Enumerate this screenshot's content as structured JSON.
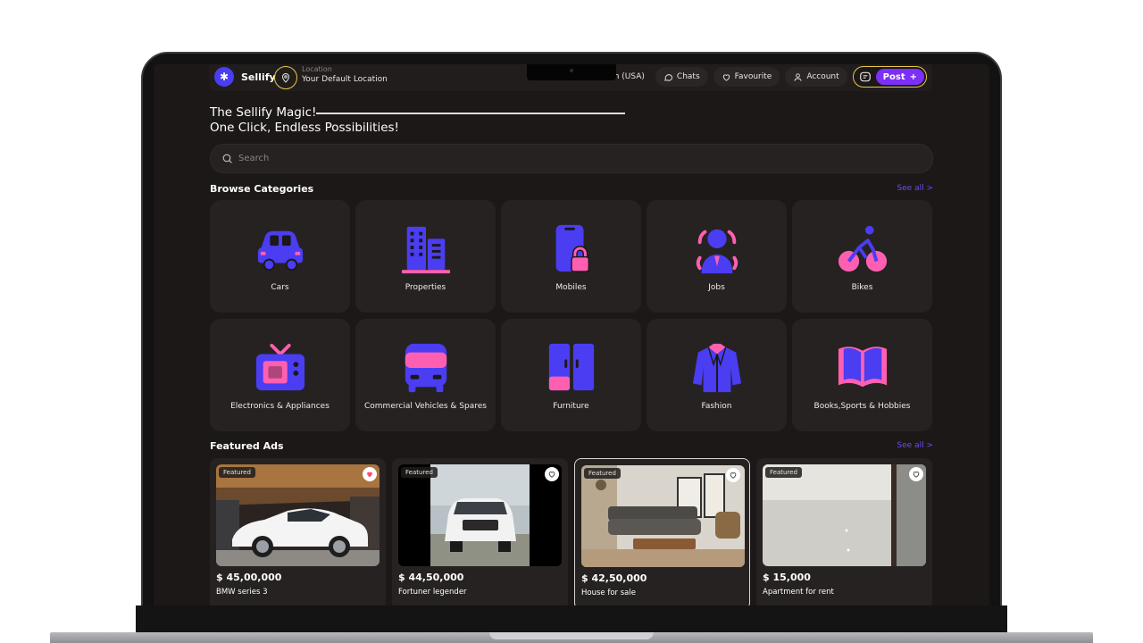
{
  "header": {
    "brand": "Sellify",
    "location_label": "Location",
    "location_value": "Your Default Location",
    "language": "English (USA)",
    "chats": "Chats",
    "favourite": "Favourite",
    "account": "Account",
    "post": "Post",
    "post_plus": "+"
  },
  "hero": {
    "line1": "The Sellify Magic!",
    "line2": "One Click, Endless Possibilities!"
  },
  "search": {
    "placeholder": "Search"
  },
  "categories": {
    "title": "Browse Categories",
    "see_all": "See all >",
    "items": [
      {
        "label": "Cars",
        "icon": "car-icon"
      },
      {
        "label": "Properties",
        "icon": "building-icon"
      },
      {
        "label": "Mobiles",
        "icon": "mobile-lock-icon"
      },
      {
        "label": "Jobs",
        "icon": "jobs-person-icon"
      },
      {
        "label": "Bikes",
        "icon": "bike-icon"
      },
      {
        "label": "Electronics & Appliances",
        "icon": "tv-icon"
      },
      {
        "label": "Commercial Vehicles & Spares",
        "icon": "bus-icon"
      },
      {
        "label": "Furniture",
        "icon": "cupboard-icon"
      },
      {
        "label": "Fashion",
        "icon": "jacket-icon"
      },
      {
        "label": "Books,Sports & Hobbies",
        "icon": "book-icon"
      }
    ]
  },
  "featured": {
    "title": "Featured Ads",
    "see_all": "See all >",
    "ads": [
      {
        "badge": "Featured",
        "price": "$ 45,00,000",
        "title": "BMW series 3",
        "favourited": true
      },
      {
        "badge": "Featured",
        "price": "$ 44,50,000",
        "title": "Fortuner legender",
        "favourited": false
      },
      {
        "badge": "Featured",
        "price": "$ 42,50,000",
        "title": "House for sale",
        "favourited": false
      },
      {
        "badge": "Featured",
        "price": "$ 15,000",
        "title": "Apartment for rent",
        "favourited": false
      }
    ]
  },
  "colors": {
    "accent_purple": "#7b2ff7",
    "icon_blue": "#4a3df2",
    "icon_pink": "#ff5fb0",
    "location_ring": "#e6c84a",
    "screen_bg": "#1b1817",
    "card_bg": "#262221"
  }
}
